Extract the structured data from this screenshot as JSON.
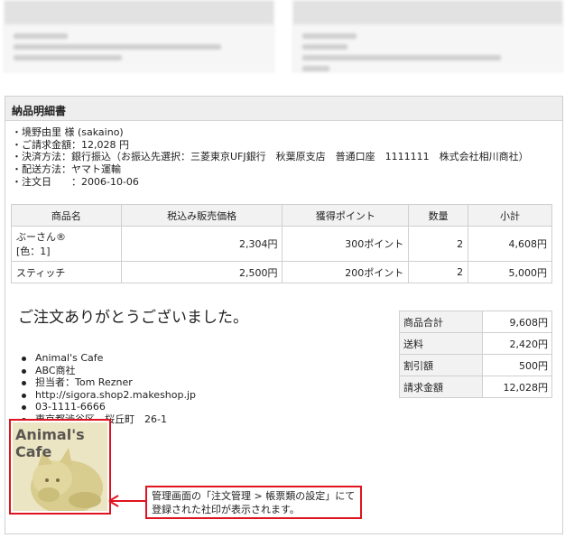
{
  "colors": {
    "accent_red": "#e0141e",
    "header_bg": "#eeeeee",
    "border": "#cfcfcf"
  },
  "panel": {
    "title": "納品明細書"
  },
  "info": {
    "lines": [
      "・境野由里 様 (sakaino)",
      "・ご請求金額：12,028 円",
      "・決済方法：銀行振込（お振込先選択：三菱東京UFJ銀行　秋葉原支店　普通口座　1111111　株式会社相川商社）",
      "・配送方法：ヤマト運輸",
      "・注文日　　：2006-10-06"
    ]
  },
  "items_table": {
    "headers": [
      "商品名",
      "税込み販売価格",
      "獲得ポイント",
      "数量",
      "小計"
    ],
    "rows": [
      {
        "name": "ぶーさん®",
        "option": "[色：1]",
        "price": "2,304円",
        "points": "300ポイント",
        "qty": "2",
        "subtotal": "4,608円"
      },
      {
        "name": "スティッチ",
        "option": "",
        "price": "2,500円",
        "points": "200ポイント",
        "qty": "2",
        "subtotal": "5,000円"
      }
    ]
  },
  "thanks": "ご注文ありがとうございました。",
  "totals": [
    {
      "label": "商品合計",
      "value": "9,608円"
    },
    {
      "label": "送料",
      "value": "2,420円"
    },
    {
      "label": "割引額",
      "value": "500円"
    },
    {
      "label": "請求金額",
      "value": "12,028円"
    }
  ],
  "shop_info": [
    "Animal's Cafe",
    "ABC商社",
    "担当者：Tom Rezner",
    "http://sigora.shop2.makeshop.jp",
    "03-1111-6666",
    "東京都渋谷区　桜丘町　26-1"
  ],
  "stamp": {
    "text": "Animal's\nCafe"
  },
  "callout": {
    "line1": "管理画面の「注文管理 > 帳票類の設定」にて",
    "line2": "登録された社印が表示されます。"
  }
}
